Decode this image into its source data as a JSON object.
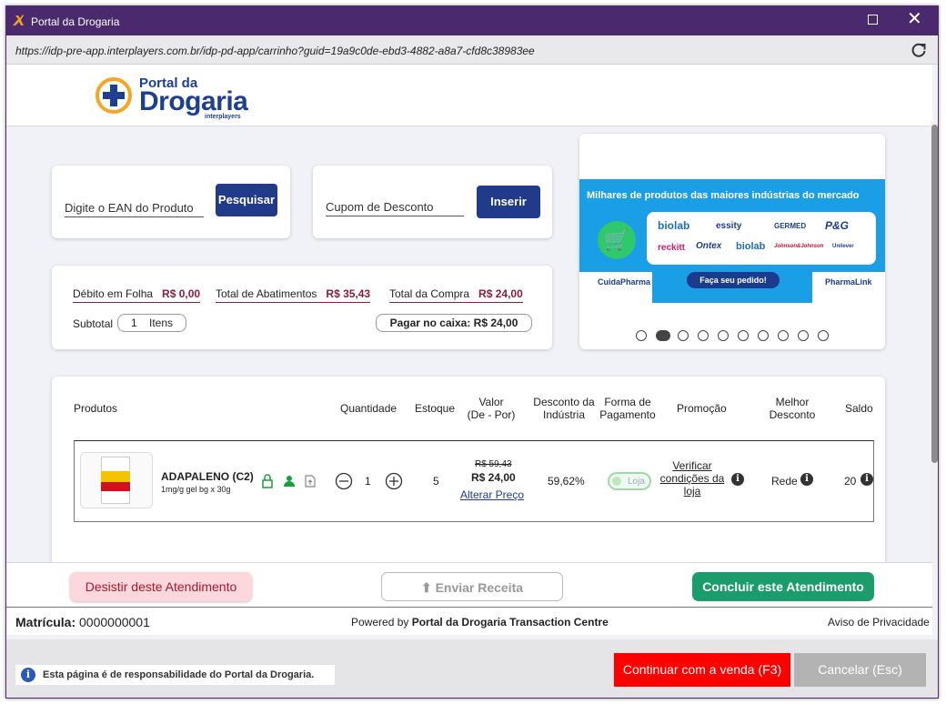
{
  "window": {
    "title": "Portal da Drogaria"
  },
  "urlbar": {
    "url": "https://idp-pre-app.interplayers.com.br/idp-pd-app/carrinho?guid=19a9c0de-ebd3-4882-a8a7-cfd8c38983ee"
  },
  "logo": {
    "small": "Portal da",
    "big": "Drogaria",
    "sub": "interplayers"
  },
  "search": {
    "placeholder": "Digite o EAN do Produto",
    "button": "Pesquisar"
  },
  "coupon": {
    "placeholder": "Cupom de Desconto",
    "button": "Inserir"
  },
  "summary": {
    "debito_label": "Débito em Folha",
    "debito_value": "R$ 0,00",
    "abatimentos_label": "Total de Abatimentos",
    "abatimentos_value": "R$ 35,43",
    "compra_label": "Total da Compra",
    "compra_value": "R$ 24,00",
    "subtotal_label": "Subtotal",
    "subtotal_count": "1",
    "subtotal_unit": "Itens",
    "caixa_label": "Pagar no caixa:",
    "caixa_value": "R$ 24,00"
  },
  "banner": {
    "headline": "Milhares de produtos das maiores indústrias do mercado",
    "brands": [
      "biolab",
      "essity",
      "GERMED",
      "P&G",
      "reckitt",
      "Ontex",
      "biolab",
      "Johnson&Johnson",
      "Unilever"
    ],
    "order_button": "Faça seu pedido!",
    "left_tag": "CuidaPharma",
    "right_tag": "PharmaLink",
    "slide_count": 10,
    "active_slide": 2
  },
  "table": {
    "headers": {
      "produtos": "Produtos",
      "quantidade": "Quantidade",
      "estoque": "Estoque",
      "valor": "Valor",
      "valor_sub": "(De - Por)",
      "desconto": "Desconto da",
      "desconto_sub": "Indústria",
      "forma": "Forma de",
      "forma_sub": "Pagamento",
      "promocao": "Promoção",
      "melhor": "Melhor",
      "melhor_sub": "Desconto",
      "saldo": "Saldo"
    },
    "row": {
      "name": "ADAPALENO (C2)",
      "desc": "1mg/g gel bg x 30g",
      "quantity": "1",
      "stock": "5",
      "price_from": "R$ 59,43",
      "price_to": "R$ 24,00",
      "alter_price": "Alterar Preço",
      "discount": "59,62%",
      "payment": "Loja",
      "promo_line1": "Verificar",
      "promo_line2": "condições da",
      "promo_line3": "loja",
      "best": "Rede",
      "balance": "20"
    }
  },
  "actions": {
    "desistir": "Desistir deste Atendimento",
    "enviar": "Enviar Receita",
    "concluir": "Concluir este Atendimento"
  },
  "status": {
    "matricula_label": "Matrícula:",
    "matricula_value": "0000000001",
    "powered": "Powered by",
    "powered_name": "Portal da Drogaria Transaction Centre",
    "privacy": "Aviso de Privacidade"
  },
  "bottom": {
    "notice": "Esta página é de responsabilidade do Portal da Drogaria.",
    "continuar": "Continuar com a venda (F3)",
    "cancelar": "Cancelar (Esc)"
  },
  "colors": {
    "brand": "#213a8a",
    "titlebar": "#4a2a6c",
    "accent_wine": "#8a1d3a",
    "green": "#1a9d6a",
    "red": "#ff0000"
  }
}
